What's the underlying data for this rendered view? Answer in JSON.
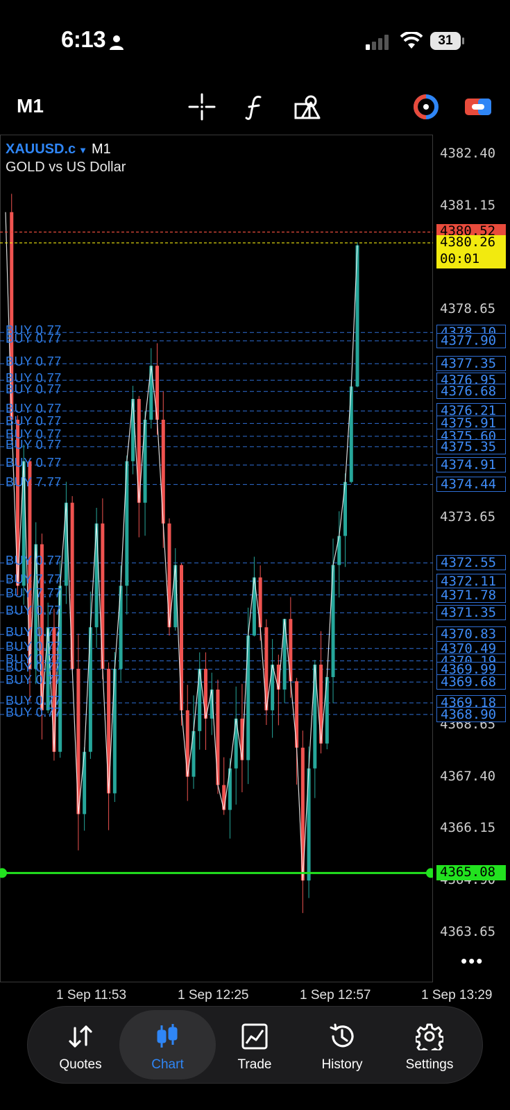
{
  "status_bar": {
    "time": "6:13",
    "battery": "31",
    "icons": [
      "person-icon",
      "cellular-signal-icon",
      "wifi-icon",
      "battery-icon"
    ]
  },
  "toolbar": {
    "timeframe": "M1",
    "icons": [
      "crosshair-icon",
      "indicators-icon",
      "objects-icon",
      "one-click-trading-icon",
      "toggle-icon"
    ]
  },
  "chart": {
    "symbol": "XAUUSD.c",
    "timeframe": "M1",
    "description": "GOLD vs US Dollar",
    "price_axis": [
      "4382.40",
      "4381.15",
      "4378.65",
      "4373.65",
      "4368.65",
      "4367.40",
      "4366.15",
      "4364.90",
      "4363.65"
    ],
    "ask_price": "4380.52",
    "bid_price": "4380.26",
    "bid_countdown": "00:01",
    "level_price": "4365.08",
    "position_prices": [
      "4378.10",
      "4377.90",
      "4377.35",
      "4376.95",
      "4376.68",
      "4376.21",
      "4375.91",
      "4375.60",
      "4375.35",
      "4374.91",
      "4374.44",
      "4372.55",
      "4372.11",
      "4371.78",
      "4371.35",
      "4370.83",
      "4370.49",
      "4370.19",
      "4369.99",
      "4369.68",
      "4369.18",
      "4368.90"
    ],
    "position_labels": [
      "BUY 0.77",
      "BUY 0.77",
      "BUY 0.77",
      "BUY 0.77",
      "BUY 0.77",
      "BUY 0.77",
      "BUY 0.77",
      "BUY 0.77",
      "BUY 0.77",
      "BUY 0.77",
      "BUY 7.77",
      "BUY 0.77",
      "BUY 7.77",
      "BUY 7.77",
      "BUY 0.77",
      "BUY 0.77",
      "BUY 0.77",
      "BUY 0.77",
      "BUY 0.77",
      "BUY 0.77",
      "BUY 0.77",
      "BUY 0.77"
    ],
    "time_axis": [
      "1 Sep 11:53",
      "1 Sep 12:25",
      "1 Sep 12:57",
      "1 Sep 13:29"
    ],
    "colors": {
      "bull": "#26a69a",
      "bear": "#ef5350",
      "ask_line": "#e84b3c",
      "bid_line": "#f2ea0f",
      "level_line": "#22e21f",
      "position_line": "#2f6fd6"
    },
    "more_label": "•••"
  },
  "tabs": [
    {
      "label": "Quotes",
      "icon": "quotes-icon",
      "active": false
    },
    {
      "label": "Chart",
      "icon": "chart-icon",
      "active": true
    },
    {
      "label": "Trade",
      "icon": "trade-icon",
      "active": false
    },
    {
      "label": "History",
      "icon": "history-icon",
      "active": false
    },
    {
      "label": "Settings",
      "icon": "settings-icon",
      "active": false
    }
  ]
}
